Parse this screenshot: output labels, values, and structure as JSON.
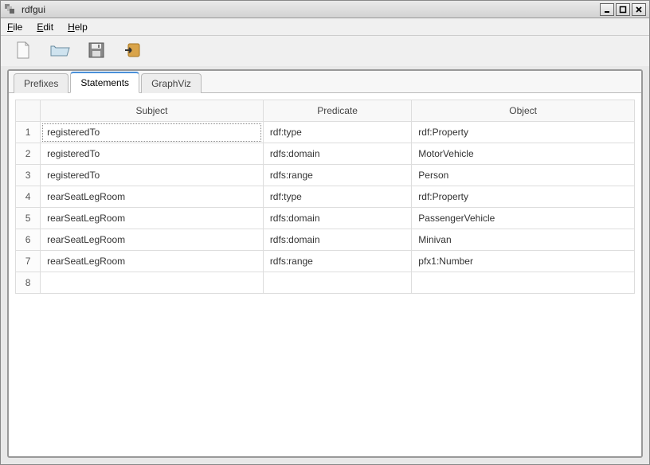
{
  "window": {
    "title": "rdfgui"
  },
  "menu": {
    "file": "File",
    "edit": "Edit",
    "help": "Help"
  },
  "toolbar": {
    "new": "new-file-icon",
    "open": "open-folder-icon",
    "save": "save-disk-icon",
    "export": "export-icon"
  },
  "tabs": {
    "prefixes": "Prefixes",
    "statements": "Statements",
    "graphviz": "GraphViz",
    "active": "statements"
  },
  "table": {
    "headers": {
      "subject": "Subject",
      "predicate": "Predicate",
      "object": "Object"
    },
    "rows": [
      {
        "n": "1",
        "subject": "registeredTo",
        "predicate": "rdf:type",
        "object": "rdf:Property"
      },
      {
        "n": "2",
        "subject": "registeredTo",
        "predicate": "rdfs:domain",
        "object": "MotorVehicle"
      },
      {
        "n": "3",
        "subject": "registeredTo",
        "predicate": "rdfs:range",
        "object": "Person"
      },
      {
        "n": "4",
        "subject": "rearSeatLegRoom",
        "predicate": "rdf:type",
        "object": "rdf:Property"
      },
      {
        "n": "5",
        "subject": "rearSeatLegRoom",
        "predicate": "rdfs:domain",
        "object": "PassengerVehicle"
      },
      {
        "n": "6",
        "subject": "rearSeatLegRoom",
        "predicate": "rdfs:domain",
        "object": "Minivan"
      },
      {
        "n": "7",
        "subject": "rearSeatLegRoom",
        "predicate": "rdfs:range",
        "object": "pfx1:Number"
      },
      {
        "n": "8",
        "subject": "",
        "predicate": "",
        "object": ""
      }
    ]
  }
}
